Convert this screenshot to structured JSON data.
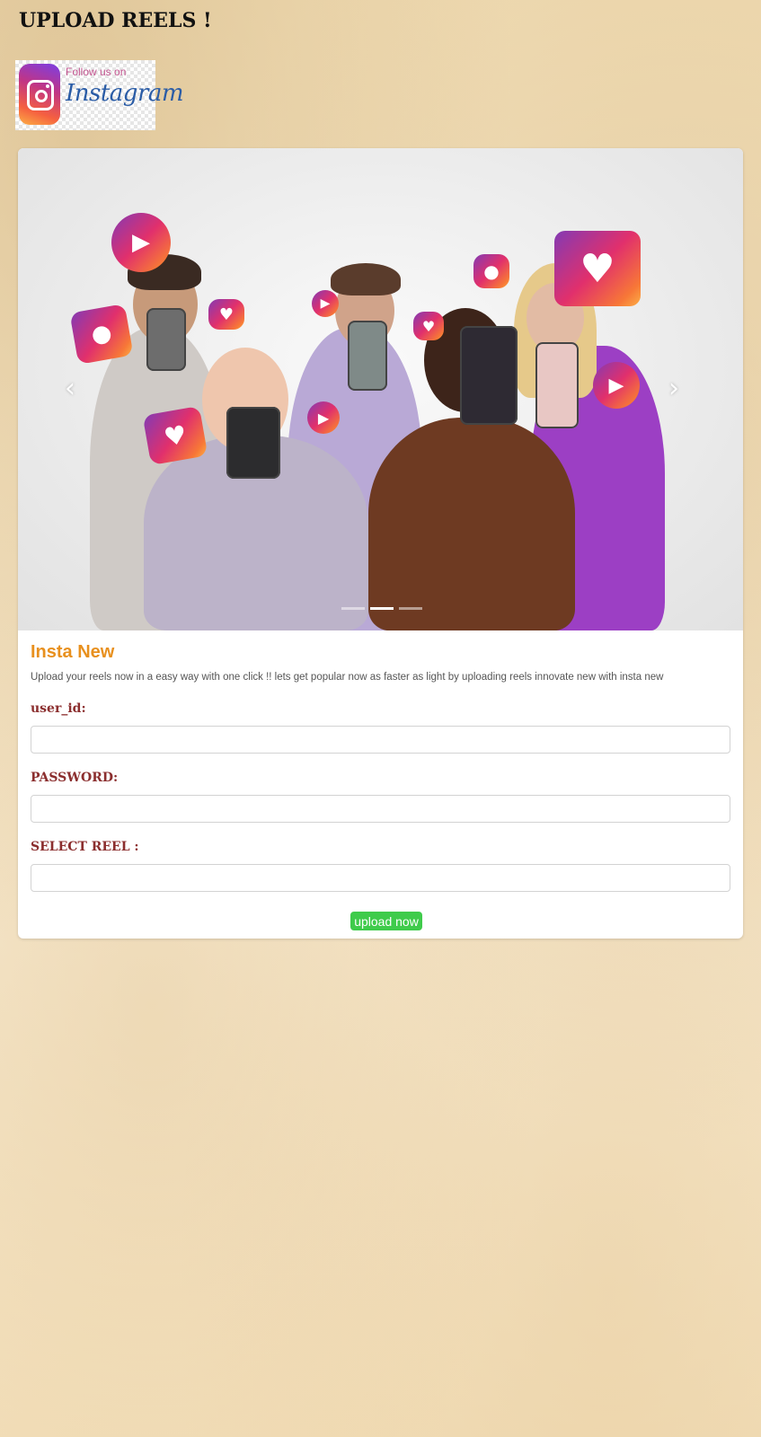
{
  "header": {
    "title": "UPLOAD REELS !"
  },
  "badge": {
    "line1": "Follow us on",
    "brand": "Instagram"
  },
  "carousel": {
    "prev_icon": "chevron-left-icon",
    "next_icon": "chevron-right-icon",
    "slide_count": 3,
    "active_slide": 2
  },
  "card": {
    "title": "Insta New",
    "text": "Upload your reels now in a easy way with one click !! lets get popular now as faster as light by uploading reels innovate new with insta new"
  },
  "form": {
    "user_id_label": "user_id:",
    "user_id_value": "",
    "password_label": "PASSWORD:",
    "password_value": "",
    "reel_label": "SELECT REEL :",
    "reel_value": "",
    "submit_label": "upload now"
  },
  "colors": {
    "title_accent": "#e8901e",
    "label_color": "#8b2e2e",
    "button_green": "#3fcb4b"
  }
}
